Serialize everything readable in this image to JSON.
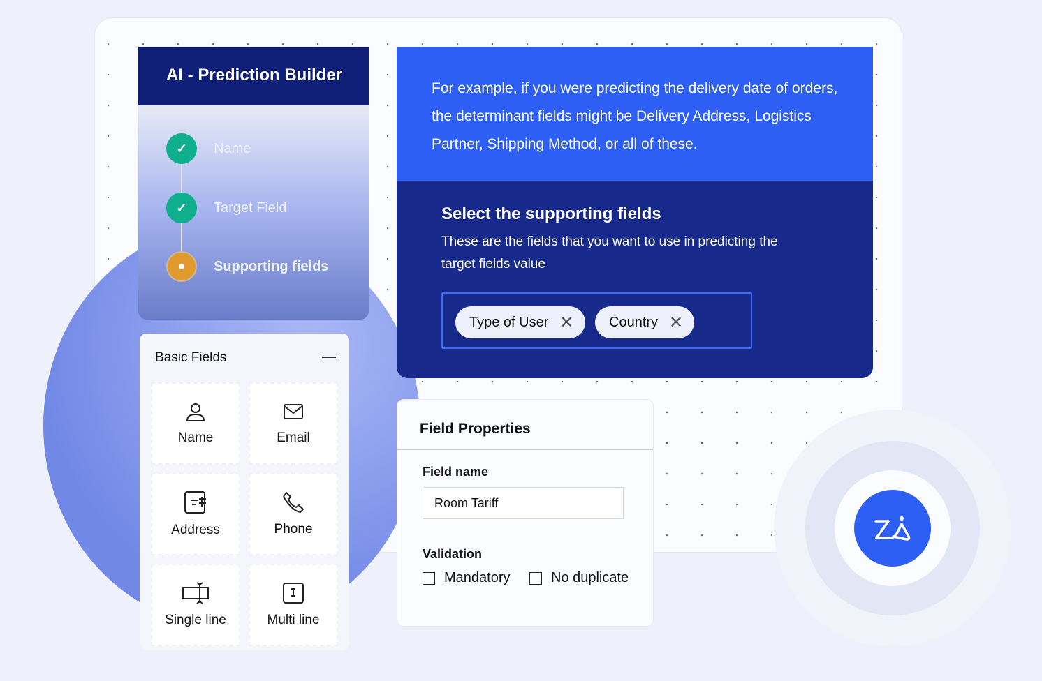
{
  "builder": {
    "title": "AI - Prediction Builder",
    "steps": [
      {
        "label": "Name",
        "status": "done"
      },
      {
        "label": "Target Field",
        "status": "done"
      },
      {
        "label": "Supporting fields",
        "status": "current"
      }
    ]
  },
  "basic_fields": {
    "title": "Basic Fields",
    "items": [
      {
        "label": "Name",
        "icon": "user-icon"
      },
      {
        "label": "Email",
        "icon": "mail-icon"
      },
      {
        "label": "Address",
        "icon": "address-icon"
      },
      {
        "label": "Phone",
        "icon": "phone-icon"
      },
      {
        "label": "Single line",
        "icon": "single-line-icon"
      },
      {
        "label": "Multi line",
        "icon": "multi-line-icon"
      }
    ]
  },
  "info": {
    "text": "For example, if you were predicting the delivery date of orders, the determinant fields might be Delivery Address, Logistics Partner, Shipping Method, or all of these."
  },
  "supporting": {
    "title": "Select the supporting fields",
    "description": "These are the fields that you want to use in predicting the target fields value",
    "chips": [
      "Type of User",
      "Country"
    ]
  },
  "field_properties": {
    "title": "Field Properties",
    "field_name_label": "Field name",
    "field_name_value": "Room Tariff",
    "validation_label": "Validation",
    "options": [
      {
        "label": "Mandatory",
        "checked": false
      },
      {
        "label": "No duplicate",
        "checked": false
      }
    ]
  },
  "logo": {
    "text": "Zia"
  },
  "colors": {
    "navy": "#0f1f78",
    "blue": "#2d5ff5",
    "done": "#0fae8d",
    "current": "#e09a2d"
  }
}
